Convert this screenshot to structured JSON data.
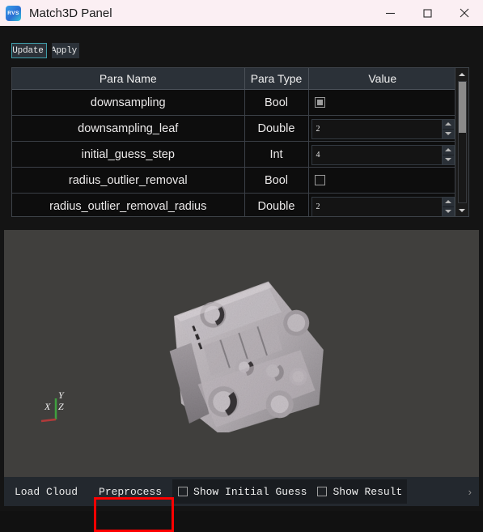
{
  "window": {
    "title": "Match3D Panel",
    "logo_text": "RVS",
    "logo_icon": "rvs-app-icon",
    "controls": {
      "minimize": "minimize-icon",
      "maximize": "maximize-icon",
      "close": "close-icon"
    }
  },
  "toolbar": {
    "update_label": "Update",
    "apply_label": "Apply"
  },
  "table": {
    "headers": [
      "Para Name",
      "Para Type",
      "Value"
    ],
    "rows": [
      {
        "name": "downsampling",
        "type": "Bool",
        "control": "checkbox",
        "checked": true,
        "value": ""
      },
      {
        "name": "downsampling_leaf",
        "type": "Double",
        "control": "spinbox",
        "checked": false,
        "value": "2"
      },
      {
        "name": "initial_guess_step",
        "type": "Int",
        "control": "spinbox",
        "checked": false,
        "value": "4"
      },
      {
        "name": "radius_outlier_removal",
        "type": "Bool",
        "control": "checkbox",
        "checked": false,
        "value": ""
      },
      {
        "name": "radius_outlier_removal_radius",
        "type": "Double",
        "control": "spinbox",
        "checked": false,
        "value": "2"
      }
    ],
    "scrollbar": {
      "up_icon": "scroll-up-arrow-icon",
      "down_icon": "scroll-down-arrow-icon"
    }
  },
  "viewport": {
    "background_color": "#403f3d",
    "point_cloud_color": "#b9b4b8",
    "axis": {
      "x_label": "X",
      "y_label": "Y",
      "z_label": "Z",
      "x_color": "#b13a3a",
      "y_color": "#3fa03f",
      "z_color": "#dcdcdc"
    }
  },
  "bottombar": {
    "load_cloud_label": "Load Cloud",
    "preprocess_label": "Preprocess",
    "show_initial_guess_label": "Show Initial Guess",
    "show_initial_guess_checked": false,
    "show_result_label": "Show Result",
    "show_result_checked": false,
    "overflow_label": "›"
  },
  "annotation": {
    "color": "#fe0000",
    "target": "preprocess-button"
  }
}
